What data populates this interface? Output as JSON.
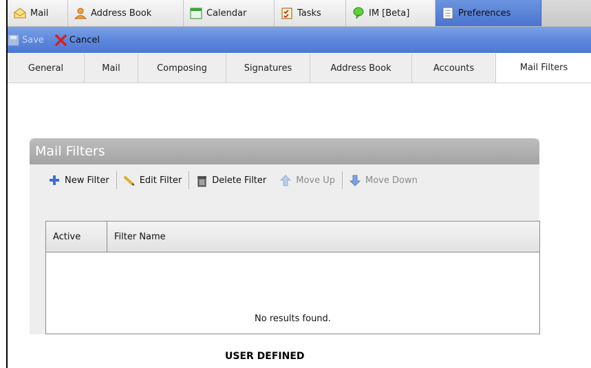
{
  "app_tabs": [
    {
      "label": "Mail",
      "icon": "mail-envelope-icon"
    },
    {
      "label": "Address Book",
      "icon": "address-book-person-icon"
    },
    {
      "label": "Calendar",
      "icon": "calendar-icon"
    },
    {
      "label": "Tasks",
      "icon": "tasks-checklist-icon"
    },
    {
      "label": "IM [Beta]",
      "icon": "im-chat-bubble-icon"
    },
    {
      "label": "Preferences",
      "icon": "preferences-list-icon"
    }
  ],
  "toolbar": {
    "save_label": "Save",
    "cancel_label": "Cancel"
  },
  "pref_tabs": [
    "General",
    "Mail",
    "Composing",
    "Signatures",
    "Address Book",
    "Accounts",
    "Mail Filters"
  ],
  "panel": {
    "title": "Mail Filters",
    "buttons": {
      "new": "New Filter",
      "edit": "Edit Filter",
      "delete": "Delete Filter",
      "up": "Move Up",
      "down": "Move Down"
    },
    "columns": [
      "Active",
      "Filter Name"
    ],
    "empty_text": "No results found."
  },
  "footer_label": "USER DEFINED",
  "colors": {
    "accent": "#5c86dc",
    "active_tab": "#4a74cf",
    "panel_header": "#b0b0b0"
  }
}
